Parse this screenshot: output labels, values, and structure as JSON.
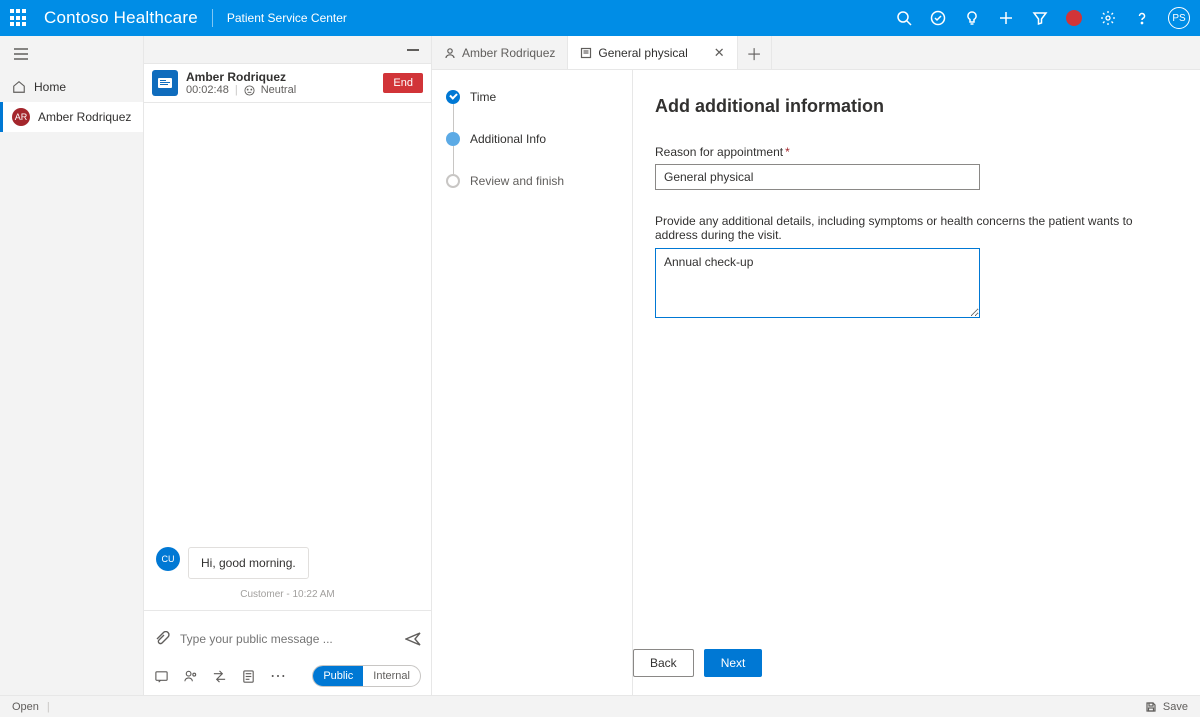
{
  "header": {
    "brand": "Contoso Healthcare",
    "subbrand": "Patient Service Center",
    "avatar_initials": "PS"
  },
  "leftnav": {
    "home_label": "Home",
    "active_item": {
      "initials": "AR",
      "label": "Amber Rodriquez"
    }
  },
  "session": {
    "name": "Amber Rodriquez",
    "duration": "00:02:48",
    "sentiment": "Neutral",
    "end_label": "End"
  },
  "chat": {
    "bubble_avatar": "CU",
    "message": "Hi, good morning.",
    "meta_sender": "Customer",
    "meta_time": "10:22 AM",
    "placeholder": "Type your public message ...",
    "toggle_public": "Public",
    "toggle_internal": "Internal"
  },
  "tabs": {
    "t1": "Amber Rodriquez",
    "t2": "General physical"
  },
  "steps": {
    "s1": "Time",
    "s2": "Additional Info",
    "s3": "Review and finish"
  },
  "form": {
    "title": "Add additional information",
    "reason_label": "Reason for appointment",
    "reason_value": "General physical",
    "details_label": "Provide any additional details, including symptoms or health concerns the patient wants to address during the visit.",
    "details_value": "Annual check-up",
    "back": "Back",
    "next": "Next"
  },
  "status": {
    "open": "Open",
    "save": "Save"
  }
}
